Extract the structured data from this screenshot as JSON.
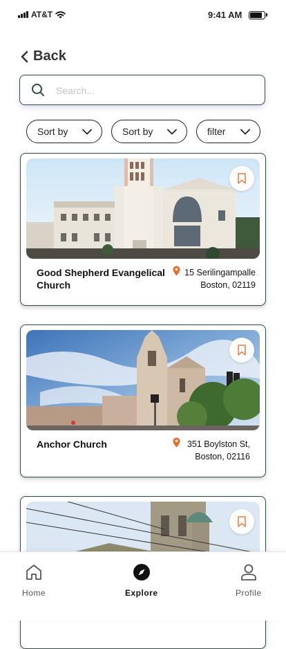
{
  "status": {
    "carrier": "AT&T",
    "time": "9:41 AM"
  },
  "header": {
    "back_label": "Back"
  },
  "search": {
    "placeholder": "Search..."
  },
  "filters": [
    {
      "label": "Sort by"
    },
    {
      "label": "Sort by"
    },
    {
      "label": "filter"
    }
  ],
  "places": [
    {
      "name": "Good Shepherd Evangelical Church",
      "address_line1": "15 Serilingampalle",
      "address_line2": "Boston, 02119",
      "bookmark_icon": "bookmark-icon"
    },
    {
      "name": "Anchor Church",
      "address_line1": "351 Boylston St,",
      "address_line2": "Boston, 02116",
      "bookmark_icon": "bookmark-icon"
    },
    {
      "name": "",
      "address_line1": "",
      "address_line2": "",
      "bookmark_icon": "bookmark-icon"
    }
  ],
  "nav": {
    "items": [
      {
        "label": "Home",
        "icon": "home-icon"
      },
      {
        "label": "Explore",
        "icon": "compass-icon",
        "active": true
      },
      {
        "label": "Profile",
        "icon": "user-icon"
      }
    ]
  },
  "colors": {
    "accent": "#2c4f41",
    "pin": "#f26522",
    "bookmark": "#e8783a"
  }
}
